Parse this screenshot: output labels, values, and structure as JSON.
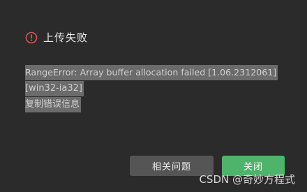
{
  "dialog": {
    "title": "上传失败",
    "icon": "error-circle-icon",
    "error_lines": [
      "RangeError: Array buffer allocation failed [1.06.2312061]",
      "[win32-ia32]",
      "复制错误信息"
    ],
    "buttons": {
      "help_label": "相关问题",
      "close_label": "关闭"
    }
  },
  "watermark": "CSDN @奇妙方程式",
  "colors": {
    "background": "#2b2b2b",
    "error_red": "#e05252",
    "selection": "#6b6b6b",
    "primary_green": "#4fb46b",
    "secondary_gray": "#555555"
  }
}
